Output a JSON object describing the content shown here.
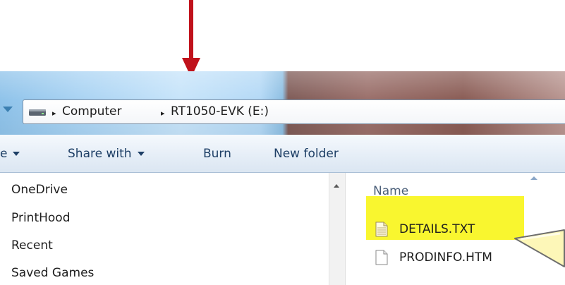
{
  "window": {
    "address_bar": {
      "location_icon": "drive-icon",
      "breadcrumbs": [
        "Computer",
        "RT1050-EVK (E:)"
      ],
      "separator": "▸"
    },
    "toolbar": {
      "organize_partial": "e",
      "share_with": "Share with",
      "burn": "Burn",
      "new_folder": "New folder"
    },
    "navigation_pane": {
      "items": [
        "OneDrive",
        "PrintHood",
        "Recent",
        "Saved Games"
      ]
    },
    "file_list": {
      "column_header": "Name",
      "files": [
        {
          "name": "DETAILS.TXT",
          "icon": "text-file-icon",
          "highlighted": true
        },
        {
          "name": "PRODINFO.HTM",
          "icon": "document-file-icon",
          "highlighted": false
        }
      ]
    }
  },
  "annotations": {
    "arrow_color": "#c0121b",
    "highlight_color": "#f9f62f",
    "pointer_color": "#fdf7b8"
  }
}
